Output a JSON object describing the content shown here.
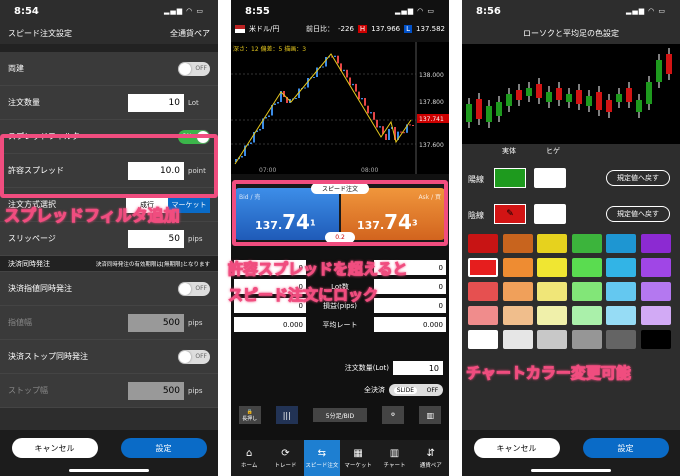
{
  "p1": {
    "time": "8:54",
    "title": "スピード注文設定",
    "pair": "全通貨ペア",
    "rows": [
      {
        "label": "両建",
        "type": "toggle",
        "state": "OFF"
      },
      {
        "label": "注文数量",
        "type": "input",
        "value": "10",
        "unit": "Lot"
      },
      {
        "label": "スプレッドフィルタ",
        "type": "toggle",
        "state": "ON"
      },
      {
        "label": "許容スプレッド",
        "type": "input",
        "value": "10.0",
        "unit": "point"
      },
      {
        "label": "注文方式選択",
        "type": "seg",
        "opts": [
          "成行",
          "マーケット"
        ]
      },
      {
        "label": "スリッページ",
        "type": "input",
        "value": "50",
        "unit": "pips"
      }
    ],
    "section": "決済同時発注",
    "section_note": "決済同時発注の有効期限は[無期限]となります",
    "rows2": [
      {
        "label": "決済指値同時発注",
        "type": "toggle",
        "state": "OFF"
      },
      {
        "label": "指値幅",
        "type": "input",
        "value": "500",
        "unit": "pips",
        "disabled": true
      },
      {
        "label": "決済ストップ同時発注",
        "type": "toggle",
        "state": "OFF"
      },
      {
        "label": "ストップ幅",
        "type": "input",
        "value": "500",
        "unit": "pips",
        "disabled": true
      }
    ],
    "cancel": "キャンセル",
    "ok": "設定",
    "caption": "スプレッドフィルタ追加"
  },
  "p2": {
    "time": "8:55",
    "pair": "米ドル/円",
    "prev_label": "前日比：",
    "prev": "-226",
    "high": "137.966",
    "low": "137.582",
    "chart_info": "深さ：12 偏差：5 描画：3",
    "y_ticks": [
      "138.000",
      "137.800",
      "137.741",
      "137.600"
    ],
    "x_ticks": [
      "07:00",
      "08:00"
    ],
    "badge_title": "スピード注文",
    "spread": "0.2",
    "bid_label": "Bid / 売",
    "bid_big": "74",
    "bid_small": "137.",
    "bid_sup": "1",
    "ask_label": "Ask / 買",
    "ask_big": "74",
    "ask_small": "137.",
    "ask_sup": "3",
    "table": [
      {
        "l": "",
        "lv": "0",
        "rv": "0"
      },
      {
        "l": "Lot数",
        "lv": "0",
        "rv": "0"
      },
      {
        "l": "損益(pips)",
        "lv": "0",
        "rv": "0"
      },
      {
        "l": "平均レート",
        "lv": "0.000",
        "rv": "0.000"
      }
    ],
    "qty_label": "注文数量(Lot)",
    "qty": "10",
    "settle_label": "全決済",
    "settle_slide": "SLIDE",
    "settle_off": "OFF",
    "tools": [
      "長押し",
      "",
      "5分足/BID",
      ""
    ],
    "tabs": [
      "ホーム",
      "トレード",
      "スピード注文",
      "マーケット",
      "チャート",
      "通貨ペア"
    ],
    "caption1": "許容スプレッドを超えると",
    "caption2": "スピード注文にロック"
  },
  "p3": {
    "time": "8:56",
    "title": "ローソクと平均足の色設定",
    "col1": "実体",
    "col2": "ヒゲ",
    "yang": "陽線",
    "yin": "陰線",
    "reset": "規定値へ戻す",
    "palette": [
      "#c81414",
      "#c8641e",
      "#e6d21e",
      "#3cb43c",
      "#1e96d2",
      "#8c2ad2",
      "#e61e1e",
      "#ee8c32",
      "#f0e632",
      "#5adc50",
      "#32b4e6",
      "#a046e6",
      "#e65050",
      "#f0a05a",
      "#f0e678",
      "#82e678",
      "#64c8f0",
      "#b478f0",
      "#f08c8c",
      "#f0be8c",
      "#f0f0aa",
      "#aaf0aa",
      "#96dcf5",
      "#d2aaf5",
      "#ffffff",
      "#e6e6e6",
      "#c8c8c8",
      "#969696",
      "#646464",
      "#000000"
    ],
    "cancel": "キャンセル",
    "ok": "設定",
    "caption": "チャートカラー変更可能"
  }
}
